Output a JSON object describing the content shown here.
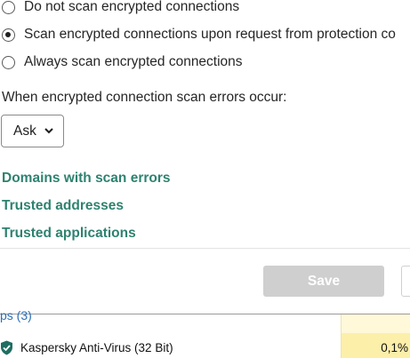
{
  "scan_options": {
    "items": [
      {
        "label": "Do not scan encrypted connections",
        "checked": false
      },
      {
        "label": "Scan encrypted connections upon request from protection co",
        "checked": true
      },
      {
        "label": "Always scan encrypted connections",
        "checked": false
      }
    ]
  },
  "scan_errors": {
    "label": "When encrypted connection scan errors occur:",
    "dropdown_value": "Ask"
  },
  "links": {
    "domains": "Domains with scan errors",
    "trusted_addresses": "Trusted addresses",
    "trusted_applications": "Trusted applications"
  },
  "footer": {
    "save_label": "Save"
  },
  "task_manager": {
    "group_header": "ps (3)",
    "process_name": "Kaspersky Anti-Virus (32 Bit)",
    "cpu_value": "0,1%",
    "colors": {
      "link": "#2e8270",
      "cpu_highlight": "#fcefaa",
      "shield": "#1f6e62"
    }
  }
}
